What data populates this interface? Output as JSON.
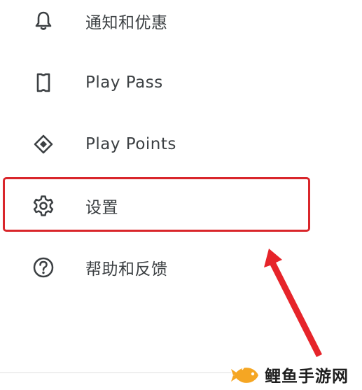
{
  "menu": {
    "items": [
      {
        "label": "通知和优惠",
        "icon": "bell-icon"
      },
      {
        "label": "Play Pass",
        "icon": "ticket-icon"
      },
      {
        "label": "Play Points",
        "icon": "diamond-icon"
      },
      {
        "label": "设置",
        "icon": "gear-icon"
      },
      {
        "label": "帮助和反馈",
        "icon": "help-circle-icon"
      }
    ]
  },
  "annotation": {
    "highlight_color": "#d9262b",
    "highlighted_item": "设置"
  },
  "watermark": {
    "text": "鲤鱼手游网",
    "logo_color": "#f5a623"
  },
  "colors": {
    "text": "#3c4043",
    "icon": "#3c4043"
  }
}
